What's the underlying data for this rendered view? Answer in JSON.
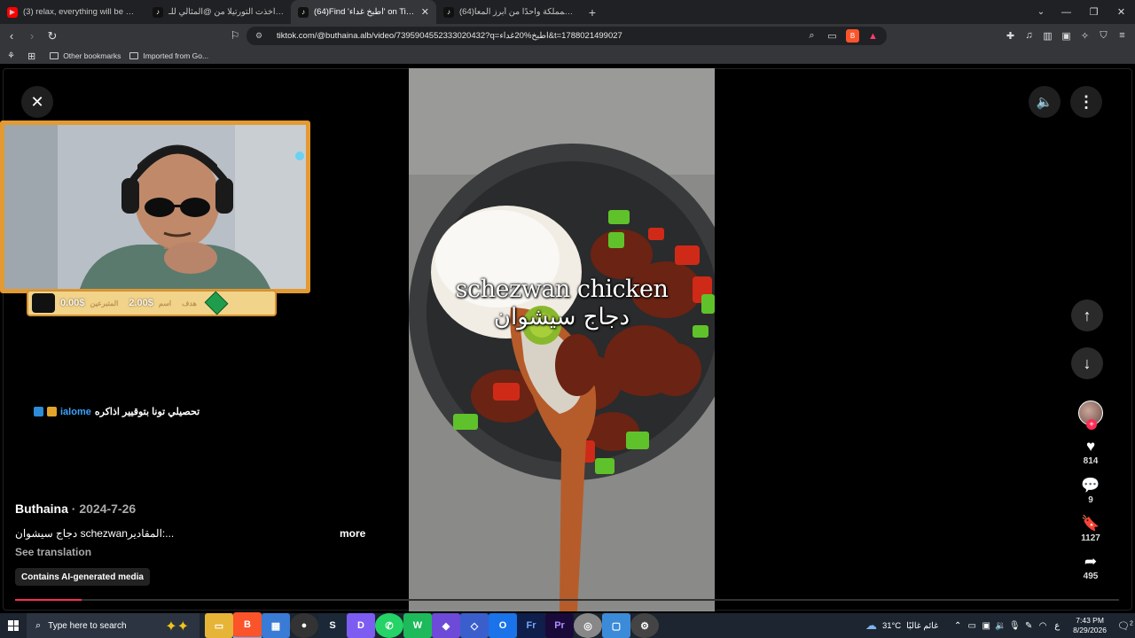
{
  "browser": {
    "tabs": [
      {
        "title": "(3) relax, everything will be okay... (m",
        "favicon": "youtube",
        "active": false
      },
      {
        "title": "انشيلادا اخذت التورتيلا من @المثالي للـ",
        "favicon": "tiktok",
        "active": false
      },
      {
        "title": "(64)Find 'اطبخ غداء' on TikTok",
        "favicon": "tiktok",
        "active": true,
        "close": "✕"
      },
      {
        "title": "(64)يعد برج المملكة واحدًا من أبرز المعا",
        "favicon": "tiktok",
        "active": false
      }
    ],
    "new_tab": "+",
    "url": "tiktok.com/@buthaina.alb/video/7395904552333020432?q=اطبخ%20غداء&t=1788021499027",
    "bookmarks": [
      {
        "label": "Other bookmarks"
      },
      {
        "label": "Imported from Go..."
      }
    ]
  },
  "video": {
    "overlay_line1": "schezwan chicken",
    "overlay_line2": "دجاج سيشوان"
  },
  "stream_overlay": {
    "donation_amount_1": "0.00$",
    "donation_label_1": "المتبرعين",
    "donation_amount_2": "2.00$",
    "donation_label_2": "اسم",
    "donation_label_3": "هدف",
    "chat_user": "ialome",
    "chat_message": "تحصيلي تونا بتوقيير اذاكره"
  },
  "post": {
    "author": "Buthaina",
    "date": " · 2024-7-26",
    "description": "دجاج سيشوان schezwanالمقادير:...",
    "more": "more",
    "see_translation": "See translation",
    "ai_label": "Contains AI-generated media",
    "progress": 0.01
  },
  "actions": {
    "likes": "814",
    "comments": "9",
    "saves": "1127",
    "shares": "495"
  },
  "taskbar": {
    "search_placeholder": "Type here to search",
    "weather_temp": "31°C",
    "weather_text": "غائم غالبًا",
    "lang": "ع",
    "time": "7:43 PM",
    "date": "8/29/2026",
    "notifications": "2"
  },
  "colors": {
    "accent": "#fe2c55",
    "frame": "#e39a33"
  }
}
